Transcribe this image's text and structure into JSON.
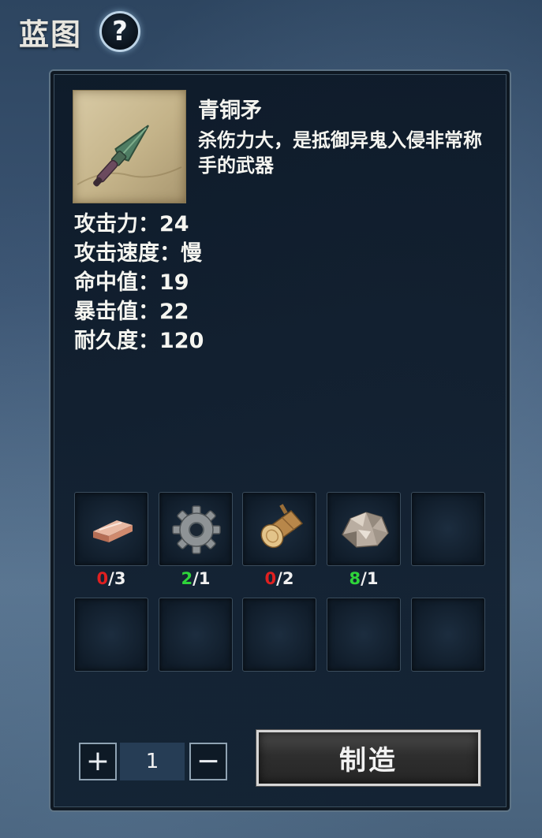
{
  "header": {
    "title": "蓝图",
    "help_label": "?"
  },
  "item": {
    "name": "青铜矛",
    "description": "杀伤力大，是抵御异鬼入侵非常称手的武器",
    "icon": "bronze-spear-icon"
  },
  "stats": [
    "攻击力：24",
    "攻击速度：慢",
    "命中值：19",
    "暴击值：22",
    "耐久度：120"
  ],
  "materials": [
    {
      "icon": "copper-ingot-icon",
      "have": "0",
      "need": "/3",
      "sufficient": false
    },
    {
      "icon": "gear-icon",
      "have": "2",
      "need": "/1",
      "sufficient": true
    },
    {
      "icon": "wood-log-icon",
      "have": "0",
      "need": "/2",
      "sufficient": false
    },
    {
      "icon": "ore-rock-icon",
      "have": "8",
      "need": "/1",
      "sufficient": true
    }
  ],
  "quantity": {
    "plus_label": "+",
    "value": "1",
    "minus_label": "−"
  },
  "craft_button": "制造",
  "colors": {
    "insufficient": "#e02020",
    "sufficient": "#2ed43a"
  }
}
